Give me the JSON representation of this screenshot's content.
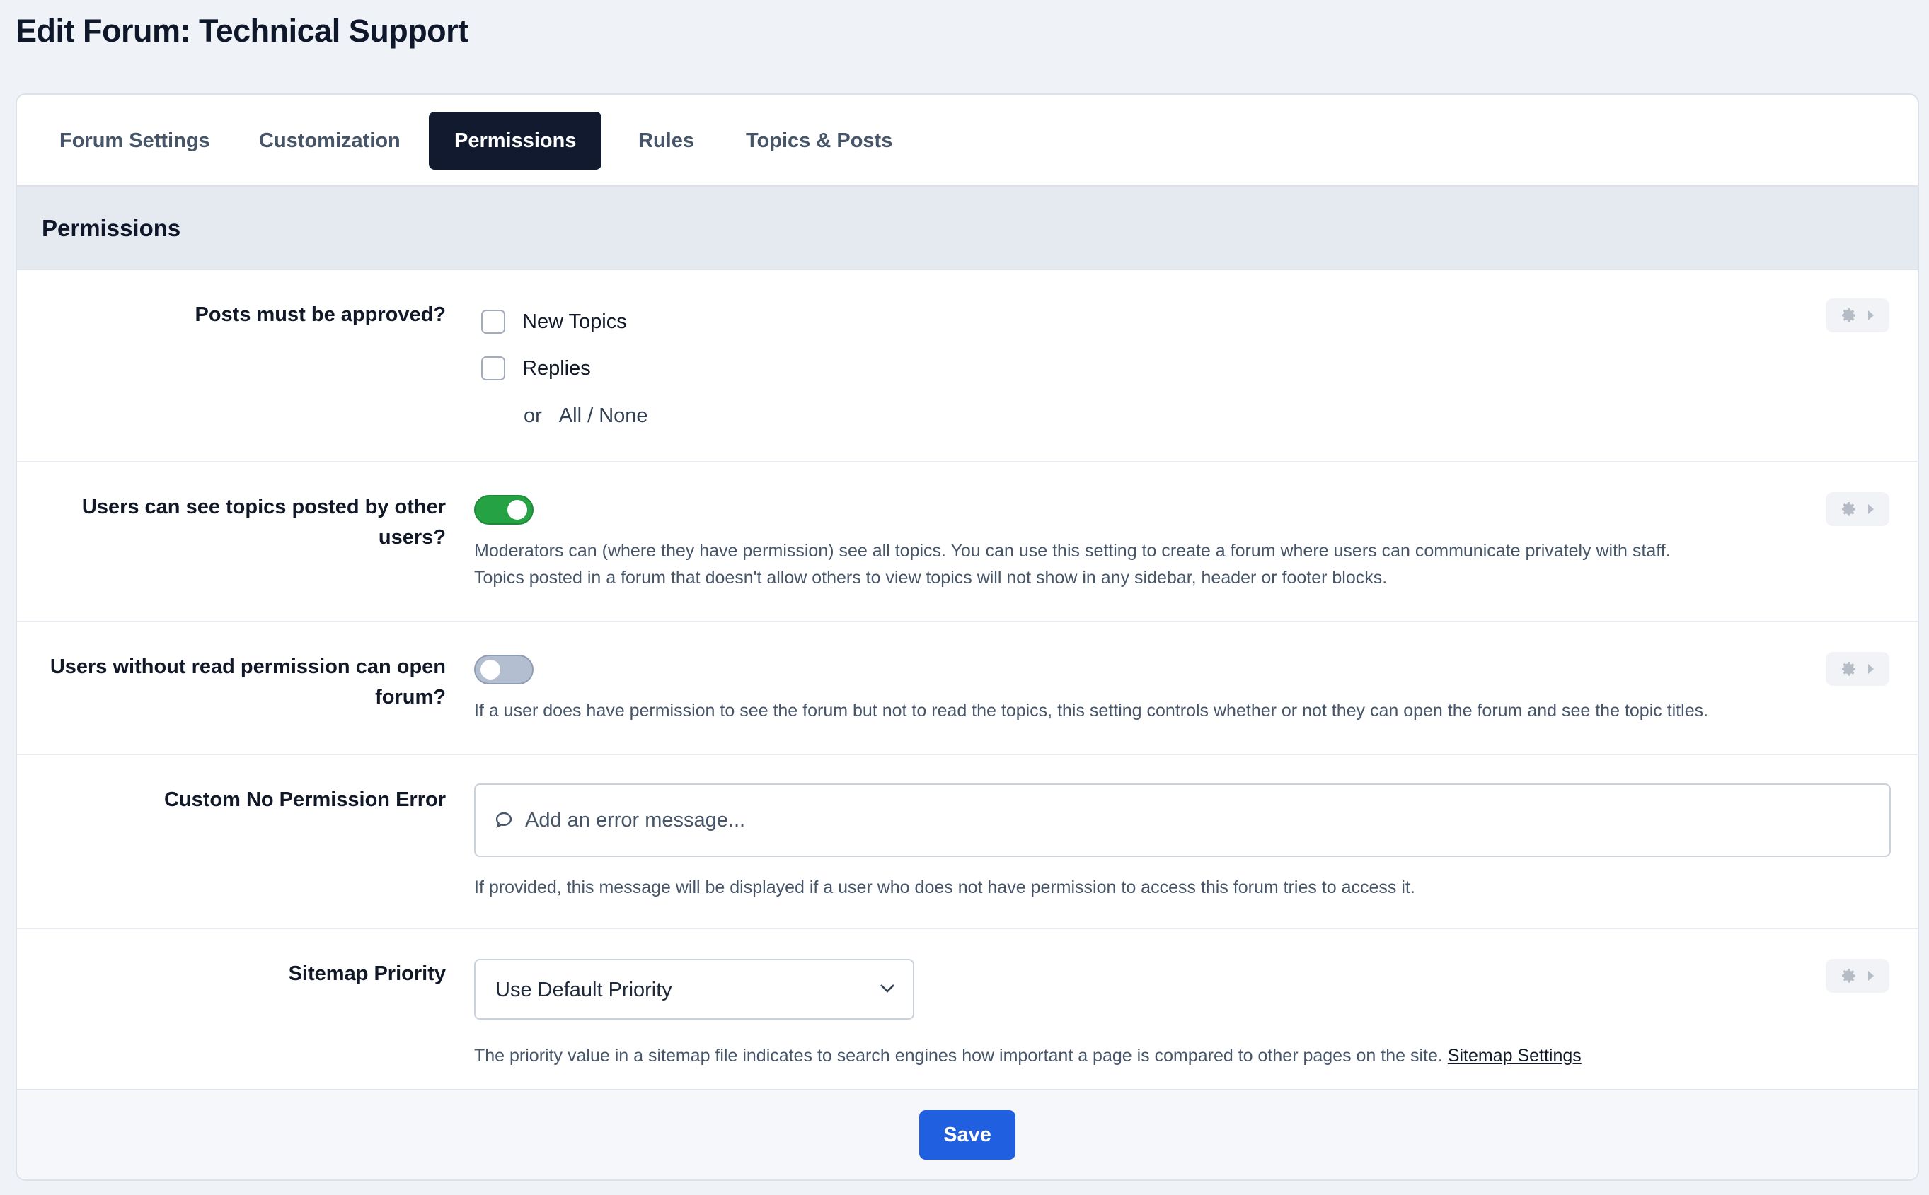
{
  "page": {
    "title": "Edit Forum: Technical Support"
  },
  "tabs": [
    {
      "label": "Forum Settings",
      "active": false
    },
    {
      "label": "Customization",
      "active": false
    },
    {
      "label": "Permissions",
      "active": true
    },
    {
      "label": "Rules",
      "active": false
    },
    {
      "label": "Topics & Posts",
      "active": false
    }
  ],
  "section": {
    "title": "Permissions"
  },
  "approval": {
    "label": "Posts must be approved?",
    "options": [
      {
        "label": "New Topics",
        "checked": false
      },
      {
        "label": "Replies",
        "checked": false
      }
    ],
    "or_text": "or",
    "all_none": "All / None"
  },
  "see_topics": {
    "label": "Users can see topics posted by other users?",
    "enabled": true,
    "help_line1": "Moderators can (where they have permission) see all topics. You can use this setting to create a forum where users can communicate privately with staff.",
    "help_line2": "Topics posted in a forum that doesn't allow others to view topics will not show in any sidebar, header or footer blocks."
  },
  "open_forum": {
    "label": "Users without read permission can open forum?",
    "enabled": false,
    "help": "If a user does have permission to see the forum but not to read the topics, this setting controls whether or not they can open the forum and see the topic titles."
  },
  "no_permission_error": {
    "label": "Custom No Permission Error",
    "value": "",
    "placeholder": "Add an error message...",
    "help": "If provided, this message will be displayed if a user who does not have permission to access this forum tries to access it."
  },
  "sitemap": {
    "label": "Sitemap Priority",
    "selected": "Use Default Priority",
    "help": "The priority value in a sitemap file indicates to search engines how important a page is compared to other pages on the site.",
    "link": "Sitemap Settings"
  },
  "footer": {
    "save_label": "Save"
  },
  "colors": {
    "toggle_on": "#25a244",
    "toggle_off": "#b3bfd1",
    "save_button": "#1f5fe0",
    "active_tab": "#111a2e"
  }
}
